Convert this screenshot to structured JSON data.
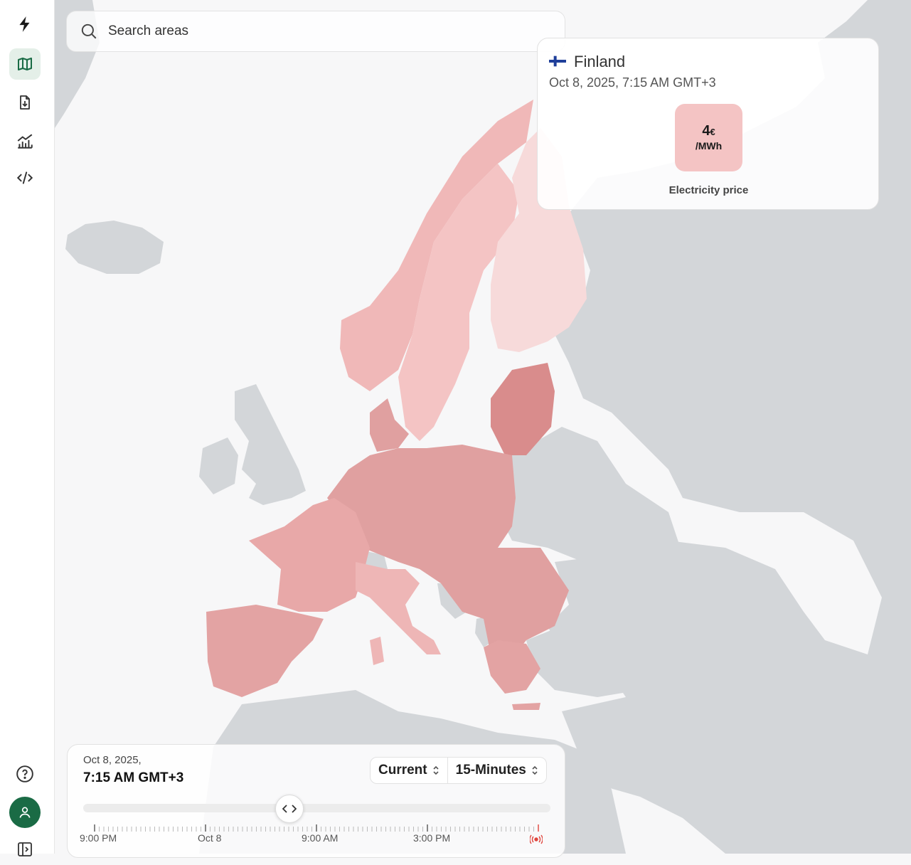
{
  "sidebar": {
    "items": [
      {
        "icon": "lightning-logo-icon",
        "active": false
      },
      {
        "icon": "map-icon",
        "active": true
      },
      {
        "icon": "file-download-icon",
        "active": false
      },
      {
        "icon": "chart-icon",
        "active": false
      },
      {
        "icon": "code-icon",
        "active": false
      }
    ],
    "bottom": [
      "help-icon",
      "user-avatar",
      "sidebar-toggle-icon"
    ]
  },
  "search": {
    "placeholder": "Search areas"
  },
  "popup": {
    "country": "Finland",
    "datetime": "Oct 8, 2025, 7:15 AM GMT+3",
    "price_value": "4",
    "price_currency": "€",
    "price_unit": "/MWh",
    "price_label": "Electricity price"
  },
  "timeline": {
    "date": "Oct 8, 2025,",
    "time": "7:15 AM GMT+3",
    "mode": "Current",
    "resolution": "15-Minutes",
    "tick_labels": [
      "9:00 PM",
      "Oct 8",
      "9:00 AM",
      "3:00 PM"
    ]
  },
  "colors": {
    "accent": "#1a6b45",
    "map_land": "#d3d6d9",
    "map_water": "#f7f7f8",
    "price_low": "#f7dada",
    "price_mid": "#f4c4c4",
    "price_high": "#e0a0a0",
    "price_highest": "#d98c8c",
    "live": "#e0443c"
  }
}
